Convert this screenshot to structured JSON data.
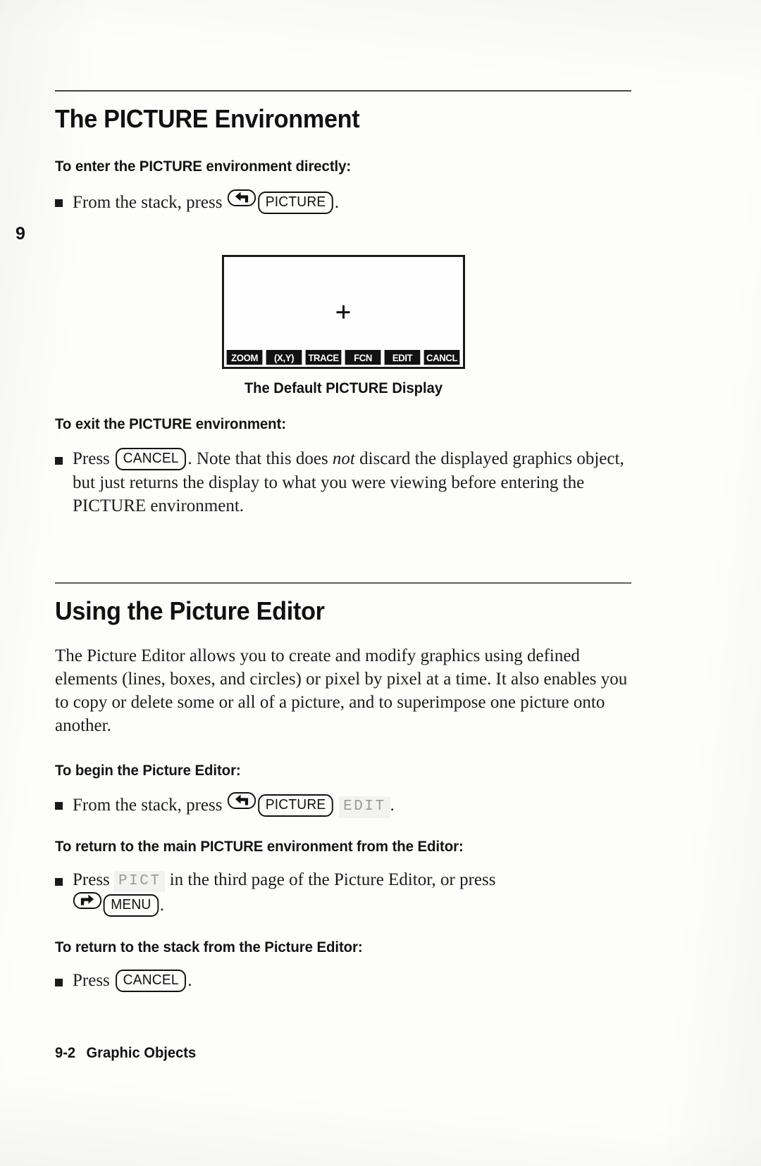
{
  "page": {
    "chapter_tab": "9",
    "footer_page_number": "9-2",
    "footer_chapter_title": "Graphic Objects"
  },
  "section1": {
    "title": "The PICTURE Environment",
    "sub1": {
      "heading": "To enter the PICTURE environment directly:",
      "bullet_prefix": "From the stack, press",
      "key_left_shift": "left-shift-arrow",
      "key_picture": "PICTURE",
      "bullet_suffix": "."
    },
    "figure": {
      "crosshair": "+",
      "menu_keys": [
        "ZOOM",
        "(X,Y)",
        "TRACE",
        "FCN",
        "EDIT",
        "CANCL"
      ],
      "caption": "The Default PICTURE Display"
    },
    "sub2": {
      "heading": "To exit the PICTURE environment:",
      "bullet_prefix": "Press",
      "key_cancel": "CANCEL",
      "text_part1": ". Note that this does ",
      "text_italic": "not",
      "text_part2": " discard the displayed graphics object, but just returns the display to what you were viewing before entering the PICTURE environment."
    }
  },
  "section2": {
    "title": "Using the Picture Editor",
    "intro": "The Picture Editor allows you to create and modify graphics using defined elements (lines, boxes, and circles) or pixel by pixel at a time. It also enables you to copy or delete some or all of a picture, and to superimpose one picture onto another.",
    "sub1": {
      "heading": "To begin the Picture Editor:",
      "bullet_prefix": "From the stack, press",
      "key_left_shift": "left-shift-arrow",
      "key_picture": "PICTURE",
      "softkey_edit": "EDIT",
      "bullet_suffix": "."
    },
    "sub2": {
      "heading": "To return to the main PICTURE environment from the Editor:",
      "bullet_prefix": "Press",
      "softkey_pict": "PICT",
      "text_middle": "in the third page of the Picture Editor, or press",
      "key_right_shift": "right-shift-arrow",
      "key_menu": "MENU",
      "bullet_suffix": "."
    },
    "sub3": {
      "heading": "To return to the stack from the Picture Editor:",
      "bullet_prefix": "Press",
      "key_cancel": "CANCEL",
      "bullet_suffix": "."
    }
  }
}
